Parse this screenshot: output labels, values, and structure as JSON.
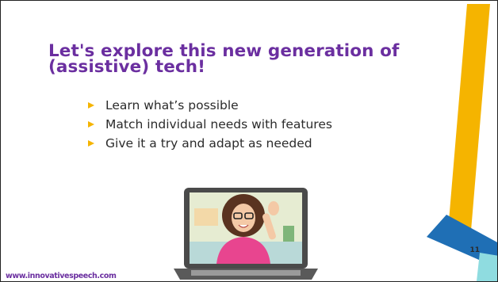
{
  "slide": {
    "title_line1": "Let's explore this new generation of",
    "title_line2": "(assistive) tech!",
    "bullets": [
      "Learn what’s possible",
      "Match individual needs with features",
      "Give it a try and adapt as needed"
    ],
    "website": "www.innovativespeech.com",
    "page_number": "11"
  },
  "colors": {
    "title": "#6b2fa0",
    "accent_yellow": "#f5b400",
    "accent_blue": "#1f6fb5",
    "accent_teal": "#8fdce0",
    "text": "#2b2b2b"
  },
  "icons": {
    "bullet": "triangle-bullet-icon",
    "illustration": "laptop-avatar-illustration"
  }
}
